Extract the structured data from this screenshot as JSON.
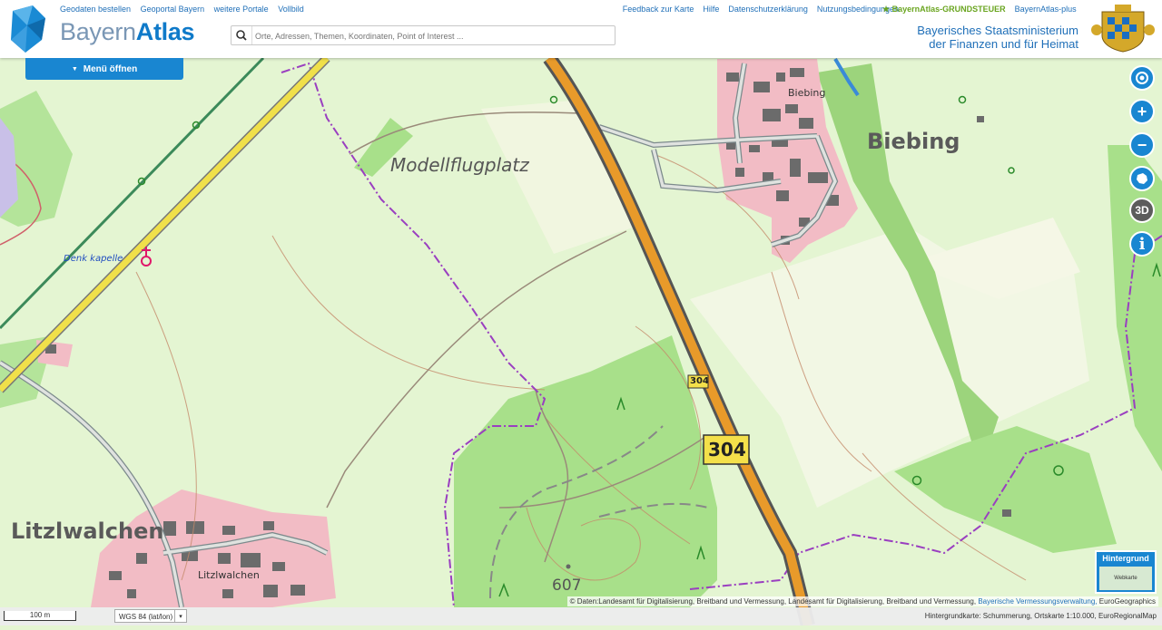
{
  "header": {
    "brand_part1": "Bayern",
    "brand_part2": "Atlas",
    "links_left": [
      "Geodaten bestellen",
      "Geoportal Bayern",
      "weitere Portale",
      "Vollbild"
    ],
    "links_right": [
      "Feedback zur Karte",
      "Hilfe",
      "Datenschutzerklärung",
      "Nutzungsbedingungen"
    ],
    "grundsteuer_link": "BayernAtlas-GRUNDSTEUER",
    "plus_link": "BayernAtlas-plus",
    "search_placeholder": "Orte, Adressen, Themen, Koordinaten, Point of Interest ...",
    "ministry_line1": "Bayerisches Staatsministerium",
    "ministry_line2": "der Finanzen und für Heimat"
  },
  "menu": {
    "label": "Menü öffnen"
  },
  "map": {
    "labels": {
      "modellflugplatz": "Modellflugplatz",
      "biebing_big": "Biebing",
      "biebing_small": "Biebing",
      "litzlwalchen_big": "Litzlwalchen",
      "litzlwalchen_small": "Litzlwalchen",
      "denkmalkapelle": "Denk  kapelle",
      "elevation": "607",
      "road_small": "304",
      "road_big": "304"
    }
  },
  "controls": {
    "threed": "3D",
    "info": "i",
    "background_title": "Hintergrund",
    "background_thumb": "Webkarte"
  },
  "footer": {
    "scale": "100 m",
    "coord_system": "WGS 84 (lat/lon)",
    "copyright_prefix": "© Daten:Landesamt für Digitalisierung, Breitband und Vermessung, Landesamt für Digitalisierung, Breitband und Vermessung,",
    "copyright_highlight": "Bayerische Vermessungsverwaltung,",
    "copyright_suffix": "EuroGeographics",
    "background_info": "Hintergrundkarte: Schummerung, Ortskarte 1:10.000, EuroRegionalMap"
  },
  "colors": {
    "accent": "#1986d1",
    "meadow": "#e4f5d2",
    "forest": "#a8e08a",
    "settlement": "#f2bcc5",
    "road": "#e89a2a",
    "border": "#9a3fc0"
  }
}
